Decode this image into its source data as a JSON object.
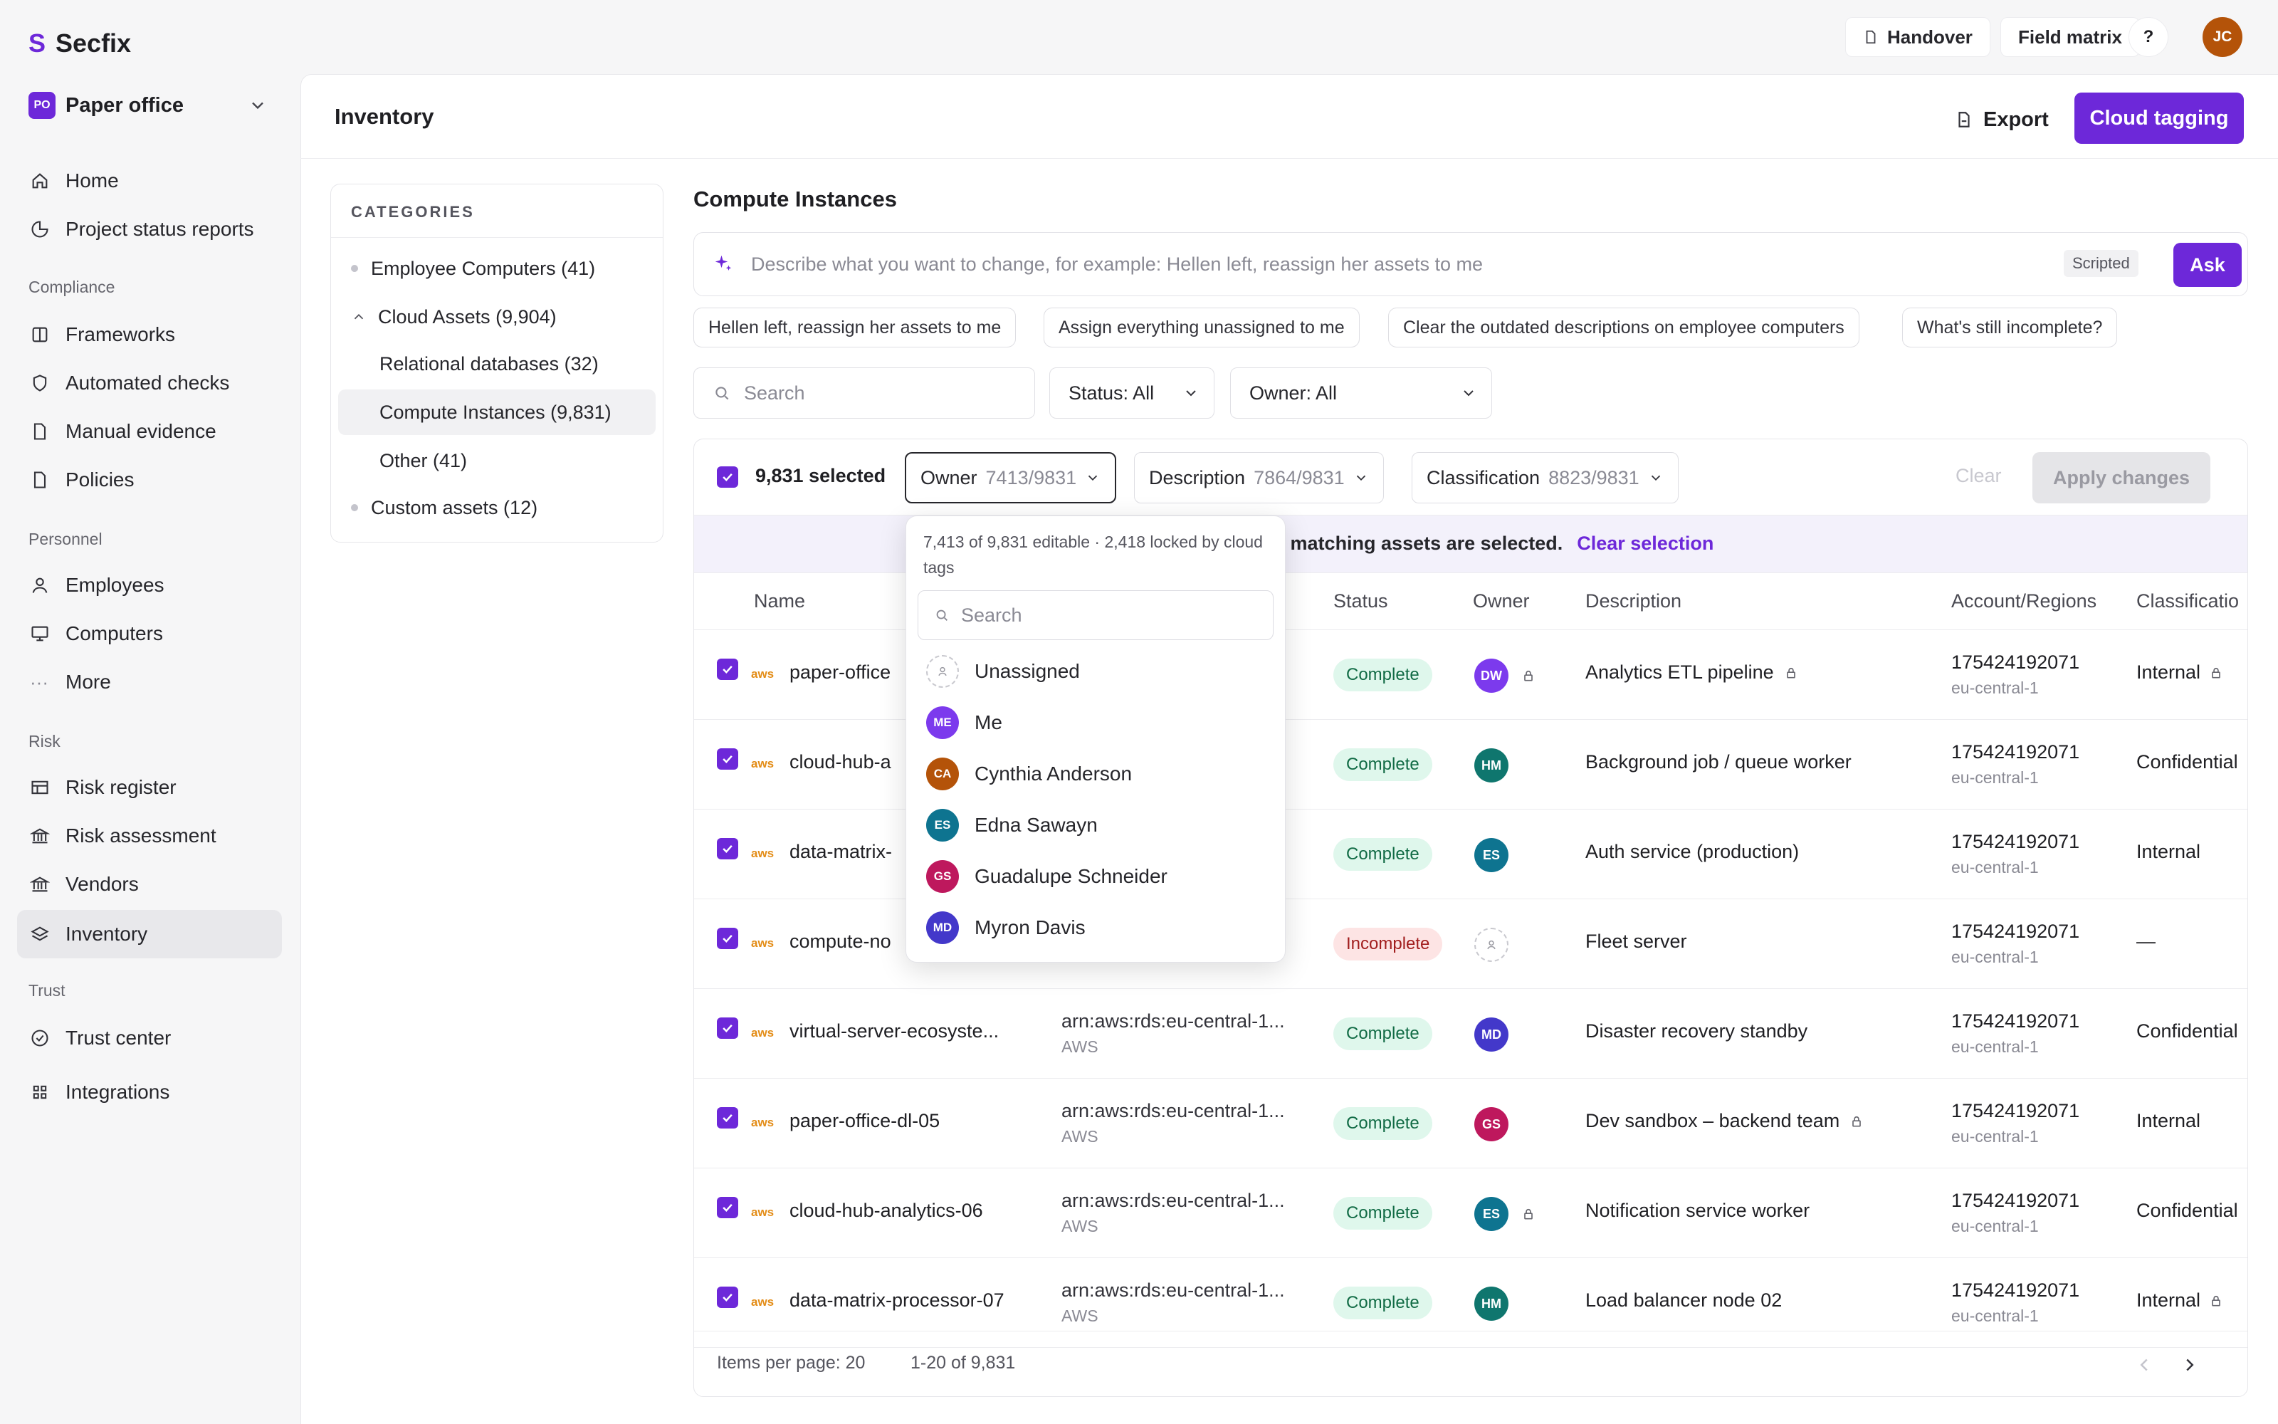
{
  "app": {
    "logo_letter": "S",
    "name": "Secfix",
    "workspace": {
      "badge": "PO",
      "name": "Paper office"
    }
  },
  "sidebar": {
    "top": [
      {
        "label": "Home",
        "icon": "home-icon"
      },
      {
        "label": "Project status reports",
        "icon": "pie-chart-icon"
      }
    ],
    "sections": [
      {
        "title": "Compliance",
        "items": [
          {
            "label": "Frameworks",
            "icon": "book-icon"
          },
          {
            "label": "Automated checks",
            "icon": "shield-icon"
          },
          {
            "label": "Manual evidence",
            "icon": "document-icon"
          },
          {
            "label": "Policies",
            "icon": "document-icon"
          }
        ]
      },
      {
        "title": "Personnel",
        "items": [
          {
            "label": "Employees",
            "icon": "user-icon"
          },
          {
            "label": "Computers",
            "icon": "monitor-icon"
          },
          {
            "label": "More",
            "icon": "ellipsis-icon"
          }
        ]
      },
      {
        "title": "Risk",
        "items": [
          {
            "label": "Risk register",
            "icon": "table-icon"
          },
          {
            "label": "Risk assessment",
            "icon": "bank-icon"
          },
          {
            "label": "Vendors",
            "icon": "bank-icon"
          },
          {
            "label": "Inventory",
            "icon": "layers-icon",
            "active": true
          }
        ]
      },
      {
        "title": "Trust",
        "items": [
          {
            "label": "Trust center",
            "icon": "check-circle-icon"
          },
          {
            "label": "Integrations",
            "icon": "grid-icon"
          }
        ]
      }
    ]
  },
  "topbar": {
    "handover": "Handover",
    "field_matrix": "Field matrix",
    "help": "?",
    "user_initials": "JC"
  },
  "page": {
    "title": "Inventory",
    "export": "Export",
    "cloud_tagging": "Cloud tagging"
  },
  "categories": {
    "title": "CATEGORIES",
    "items": [
      {
        "label": "Employee Computers (41)"
      },
      {
        "label": "Cloud Assets (9,904)"
      },
      {
        "label": "Relational databases (32)"
      },
      {
        "label": "Compute Instances (9,831)",
        "active": true
      },
      {
        "label": "Other (41)"
      },
      {
        "label": "Custom assets (12)"
      }
    ]
  },
  "compute": {
    "title": "Compute Instances",
    "ask": {
      "placeholder": "Describe what you want to change, for example: Hellen left, reassign her assets to me",
      "mode": "Scripted",
      "button": "Ask"
    },
    "suggestions": [
      "Hellen left, reassign her assets to me",
      "Assign everything unassigned to me",
      "Clear the outdated descriptions on employee computers",
      "What's still incomplete?"
    ],
    "search_placeholder": "Search",
    "status_filter": "Status: All",
    "owner_filter": "Owner: All"
  },
  "bulk": {
    "selected": "9,831 selected",
    "owner": {
      "label": "Owner",
      "count": "7413/9831"
    },
    "description": {
      "label": "Description",
      "count": "7864/9831"
    },
    "classification": {
      "label": "Classification",
      "count": "8823/9831"
    },
    "clear": "Clear",
    "apply": "Apply changes",
    "banner_text": "31 matching assets are selected.",
    "banner_link": "Clear selection"
  },
  "table": {
    "headers": {
      "name": "Name",
      "status": "Status",
      "owner": "Owner",
      "description": "Description",
      "account": "Account/Regions",
      "classification": "Classificatio"
    },
    "rows": [
      {
        "name": "paper-office",
        "arn": "…",
        "provider": "",
        "status": "Complete",
        "owner_initials": "DW",
        "owner_color": "#7c3aed",
        "owner_locked": true,
        "description": "Analytics ETL pipeline",
        "desc_locked": true,
        "account": "175424192071",
        "region": "eu-central-1",
        "classification": "Internal",
        "cls_locked": true
      },
      {
        "name": "cloud-hub-a",
        "arn": "…",
        "provider": "",
        "status": "Complete",
        "owner_initials": "HM",
        "owner_color": "#0f766e",
        "owner_locked": false,
        "description": "Background job / queue worker",
        "desc_locked": false,
        "account": "175424192071",
        "region": "eu-central-1",
        "classification": "Confidential",
        "cls_locked": false
      },
      {
        "name": "data-matrix-",
        "arn": "…",
        "provider": "",
        "status": "Complete",
        "owner_initials": "ES",
        "owner_color": "#0e7490",
        "owner_locked": false,
        "description": "Auth service (production)",
        "desc_locked": false,
        "account": "175424192071",
        "region": "eu-central-1",
        "classification": "Internal",
        "cls_locked": false
      },
      {
        "name": "compute-no",
        "arn": "",
        "provider": "AWS",
        "status": "Incomplete",
        "owner_initials": "",
        "owner_color": "",
        "owner_locked": false,
        "description": "Fleet server",
        "desc_locked": false,
        "account": "175424192071",
        "region": "eu-central-1",
        "classification": "—",
        "cls_locked": false
      },
      {
        "name": "virtual-server-ecosyste...",
        "arn": "arn:aws:rds:eu-central-1...",
        "provider": "AWS",
        "status": "Complete",
        "owner_initials": "MD",
        "owner_color": "#4338ca",
        "owner_locked": false,
        "description": "Disaster recovery standby",
        "desc_locked": false,
        "account": "175424192071",
        "region": "eu-central-1",
        "classification": "Confidential",
        "cls_locked": false
      },
      {
        "name": "paper-office-dl-05",
        "arn": "arn:aws:rds:eu-central-1...",
        "provider": "AWS",
        "status": "Complete",
        "owner_initials": "GS",
        "owner_color": "#be185d",
        "owner_locked": false,
        "description": "Dev sandbox – backend team",
        "desc_locked": true,
        "account": "175424192071",
        "region": "eu-central-1",
        "classification": "Internal",
        "cls_locked": false
      },
      {
        "name": "cloud-hub-analytics-06",
        "arn": "arn:aws:rds:eu-central-1...",
        "provider": "AWS",
        "status": "Complete",
        "owner_initials": "ES",
        "owner_color": "#0e7490",
        "owner_locked": true,
        "description": "Notification service worker",
        "desc_locked": false,
        "account": "175424192071",
        "region": "eu-central-1",
        "classification": "Confidential",
        "cls_locked": false
      },
      {
        "name": "data-matrix-processor-07",
        "arn": "arn:aws:rds:eu-central-1...",
        "provider": "AWS",
        "status": "Complete",
        "owner_initials": "HM",
        "owner_color": "#0f766e",
        "owner_locked": false,
        "description": "Load balancer node 02",
        "desc_locked": false,
        "account": "175424192071",
        "region": "eu-central-1",
        "classification": "Internal",
        "cls_locked": true
      }
    ],
    "footer": {
      "per_page": "Items per page: 20",
      "range": "1-20 of 9,831"
    }
  },
  "owner_dropdown": {
    "note": "7,413 of 9,831 editable · 2,418 locked by cloud tags",
    "search_placeholder": "Search",
    "options": [
      {
        "label": "Unassigned",
        "initials": "",
        "color": ""
      },
      {
        "label": "Me",
        "initials": "ME",
        "color": "#7c3aed"
      },
      {
        "label": "Cynthia Anderson",
        "initials": "CA",
        "color": "#b45309"
      },
      {
        "label": "Edna Sawayn",
        "initials": "ES",
        "color": "#0e7490"
      },
      {
        "label": "Guadalupe Schneider",
        "initials": "GS",
        "color": "#be185d"
      },
      {
        "label": "Myron Davis",
        "initials": "MD",
        "color": "#4338ca"
      }
    ]
  }
}
